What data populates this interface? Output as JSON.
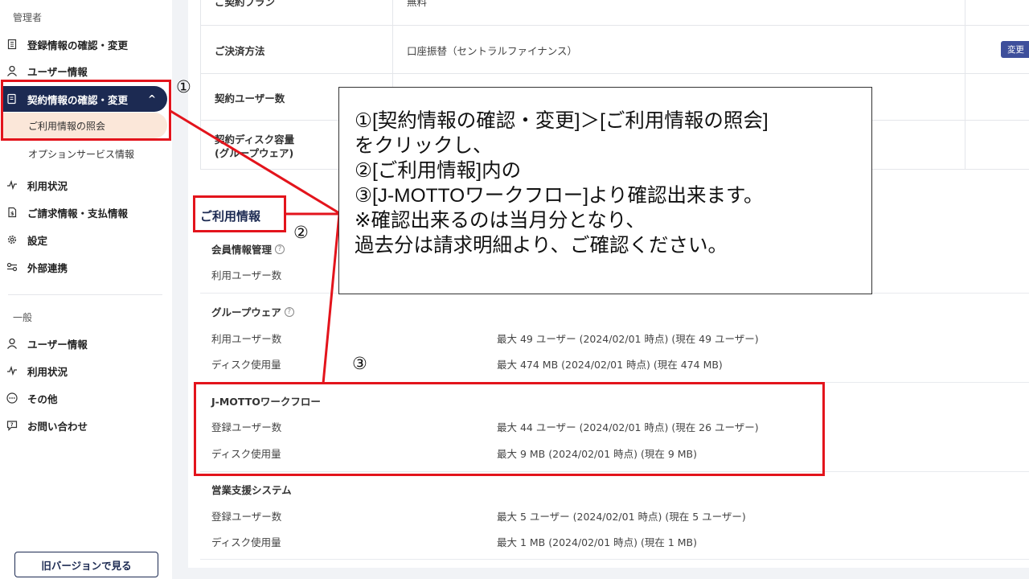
{
  "sidebar": {
    "admin_section": "管理者",
    "admin_items": [
      {
        "label": "登録情報の確認・変更",
        "icon": "building-icon"
      },
      {
        "label": "ユーザー情報",
        "icon": "person-icon"
      },
      {
        "label": "契約情報の確認・変更",
        "icon": "document-icon",
        "active": true,
        "expanded": true
      },
      {
        "label": "利用状況",
        "icon": "pulse-icon"
      },
      {
        "label": "ご請求情報・支払情報",
        "icon": "invoice-icon"
      },
      {
        "label": "設定",
        "icon": "gear-icon"
      },
      {
        "label": "外部連携",
        "icon": "link-icon"
      }
    ],
    "sub_items": [
      {
        "label": "ご利用情報の照会",
        "active": true
      },
      {
        "label": "オプションサービス情報"
      }
    ],
    "expand_glyph": "^",
    "general_section": "一般",
    "general_items": [
      {
        "label": "ユーザー情報",
        "icon": "person-icon"
      },
      {
        "label": "利用状況",
        "icon": "pulse-icon"
      },
      {
        "label": "その他",
        "icon": "more-icon"
      },
      {
        "label": "お問い合わせ",
        "icon": "chat-icon"
      }
    ],
    "old_version_button": "旧バージョンで見る"
  },
  "contract": {
    "rows": [
      {
        "label": "ご契約プラン",
        "value": "無料"
      },
      {
        "label": "ご決済方法",
        "value": "口座振替（セントラルファイナンス）"
      },
      {
        "label": "契約ユーザー数",
        "value": ""
      },
      {
        "label": "契約ディスク容量",
        "label2": "(グループウェア)",
        "value": ""
      }
    ],
    "change_button": "変更"
  },
  "usage": {
    "title": "ご利用情報",
    "groups": [
      {
        "title": "会員情報管理",
        "help": "?",
        "rows": [
          {
            "label": "利用ユーザー数",
            "value": ""
          }
        ]
      },
      {
        "title": "グループウェア",
        "help": "?",
        "rows": [
          {
            "label": "利用ユーザー数",
            "value": "最大 49 ユーザー (2024/02/01 時点) (現在 49 ユーザー)"
          },
          {
            "label": "ディスク使用量",
            "value": "最大 474 MB (2024/02/01 時点) (現在 474 MB)"
          }
        ]
      },
      {
        "title": "J-MOTTOワークフロー",
        "rows": [
          {
            "label": "登録ユーザー数",
            "value": "最大 44 ユーザー (2024/02/01 時点) (現在 26 ユーザー)"
          },
          {
            "label": "ディスク使用量",
            "value": "最大 9 MB (2024/02/01 時点) (現在 9 MB)"
          }
        ]
      },
      {
        "title": "営業支援システム",
        "rows": [
          {
            "label": "登録ユーザー数",
            "value": "最大 5 ユーザー (2024/02/01 時点) (現在 5 ユーザー)"
          },
          {
            "label": "ディスク使用量",
            "value": "最大 1 MB (2024/02/01 時点) (現在 1 MB)"
          }
        ]
      }
    ]
  },
  "annotation": {
    "lines": [
      "①[契約情報の確認・変更]＞[ご利用情報の照会]",
      "をクリックし、",
      "②[ご利用情報]内の",
      "③[J-MOTTOワークフロー]より確認出来ます。",
      "※確認出来るのは当月分となり、",
      "過去分は請求明細より、ご確認ください。"
    ],
    "markers": [
      "①",
      "②",
      "③"
    ],
    "highlight_color": "#e3141c"
  }
}
